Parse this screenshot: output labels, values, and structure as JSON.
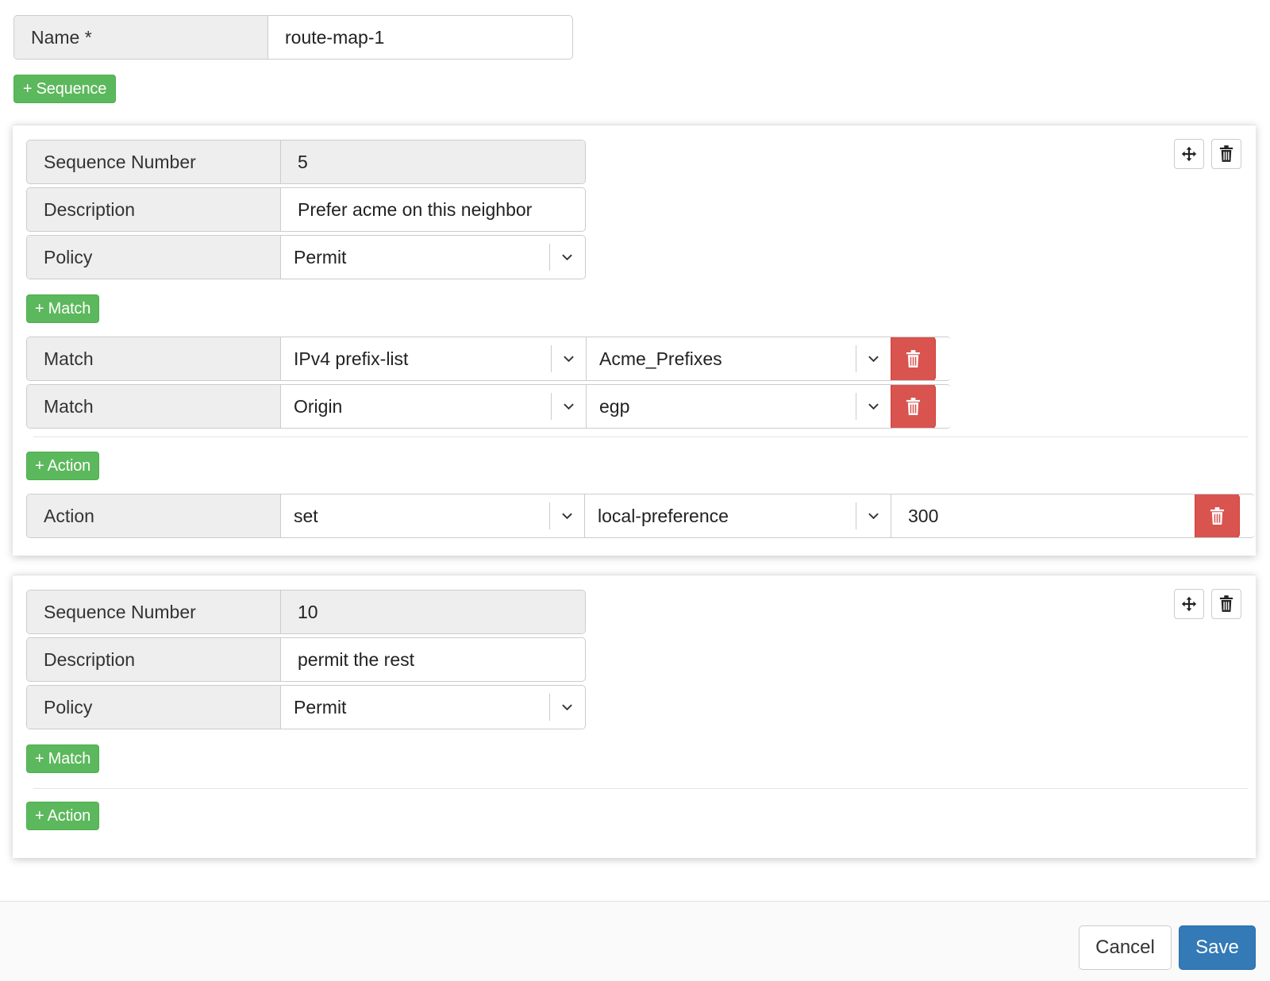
{
  "name_field": {
    "label": "Name *",
    "value": "route-map-1"
  },
  "add_sequence_label": "+ Sequence",
  "sequences": [
    {
      "sequence_number": {
        "label": "Sequence Number",
        "value": "5"
      },
      "description": {
        "label": "Description",
        "value": "Prefer acme on this neighbor"
      },
      "policy": {
        "label": "Policy",
        "value": "Permit"
      },
      "add_match_label": "+ Match",
      "matches": [
        {
          "label": "Match",
          "type": "IPv4 prefix-list",
          "value": "Acme_Prefixes"
        },
        {
          "label": "Match",
          "type": "Origin",
          "value": "egp"
        }
      ],
      "add_action_label": "+ Action",
      "actions": [
        {
          "label": "Action",
          "verb": "set",
          "attribute": "local-preference",
          "value": "300"
        }
      ]
    },
    {
      "sequence_number": {
        "label": "Sequence Number",
        "value": "10"
      },
      "description": {
        "label": "Description",
        "value": "permit the rest"
      },
      "policy": {
        "label": "Policy",
        "value": "Permit"
      },
      "add_match_label": "+ Match",
      "add_action_label": "+ Action"
    }
  ],
  "footer": {
    "cancel_label": "Cancel",
    "save_label": "Save"
  },
  "icons": {
    "move": "move-icon",
    "trash": "trash-icon",
    "caret": "chevron-down-icon"
  },
  "colors": {
    "success": "#5cb85c",
    "danger": "#d9534f",
    "primary": "#337ab7",
    "addon_bg": "#eeeeee"
  }
}
